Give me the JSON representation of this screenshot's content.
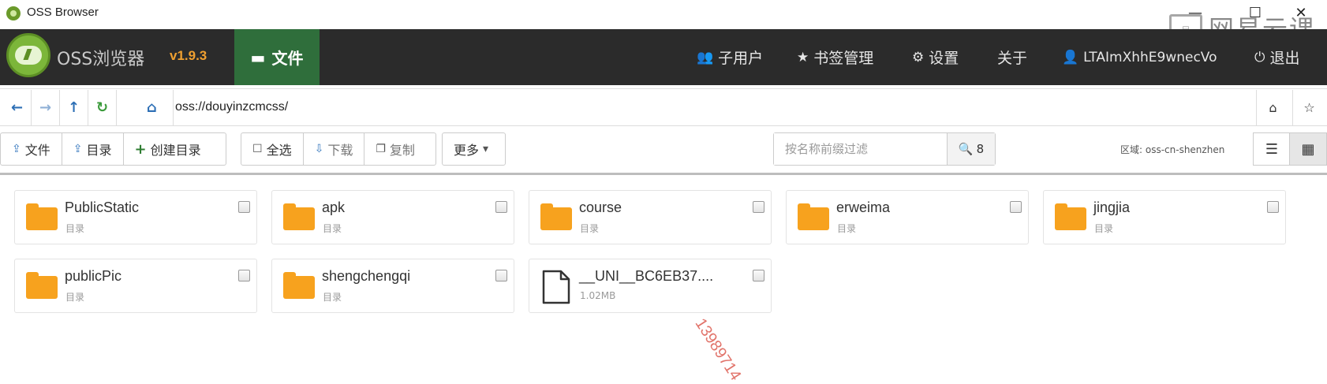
{
  "window": {
    "title": "OSS Browser",
    "controls": [
      "—",
      "☐",
      "✕"
    ],
    "overlay_logo_text": "网易云课"
  },
  "header": {
    "brand": "OSS浏览器",
    "version": "v1.9.3",
    "active_tab": "文件",
    "nav": [
      {
        "label": "子用户",
        "icon": "users-icon"
      },
      {
        "label": "书签管理",
        "icon": "star-icon"
      },
      {
        "label": "设置",
        "icon": "gear-icon"
      },
      {
        "label": "关于",
        "icon": ""
      },
      {
        "label": "LTAImXhhE9wnecVo",
        "icon": "user-icon"
      },
      {
        "label": "退出",
        "icon": "power-icon"
      }
    ]
  },
  "addressbar": {
    "path": "oss://douyinzcmcss/"
  },
  "toolbar": {
    "upload_file": "文件",
    "upload_dir": "目录",
    "create_dir": "创建目录",
    "select_all": "全选",
    "download": "下载",
    "copy": "复制",
    "more": "更多",
    "filter_placeholder": "按名称前缀过滤",
    "result_count": "8",
    "region": "区域: oss-cn-shenzhen"
  },
  "items": [
    {
      "name": "PublicStatic",
      "sub": "目录",
      "type": "folder"
    },
    {
      "name": "apk",
      "sub": "目录",
      "type": "folder"
    },
    {
      "name": "course",
      "sub": "目录",
      "type": "folder"
    },
    {
      "name": "erweima",
      "sub": "目录",
      "type": "folder"
    },
    {
      "name": "jingjia",
      "sub": "目录",
      "type": "folder"
    },
    {
      "name": "publicPic",
      "sub": "目录",
      "type": "folder"
    },
    {
      "name": "shengchengqi",
      "sub": "目录",
      "type": "folder"
    },
    {
      "name": "__UNI__BC6EB37....",
      "sub": "1.02MB",
      "type": "file"
    }
  ],
  "stamp": "13989714"
}
